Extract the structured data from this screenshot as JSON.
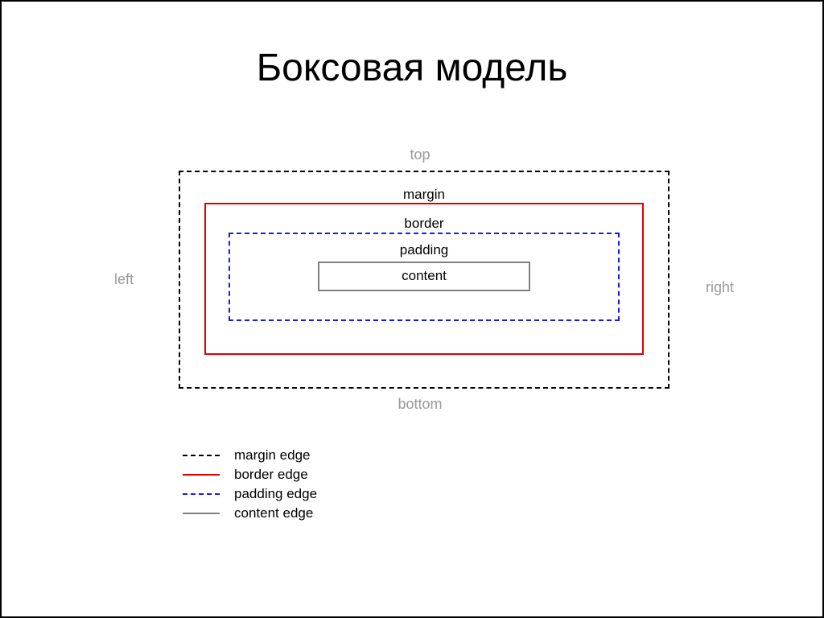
{
  "title": "Боксовая модель",
  "directions": {
    "top": "top",
    "left": "left",
    "right": "right",
    "bottom": "bottom"
  },
  "boxes": {
    "margin": "margin",
    "border": "border",
    "padding": "padding",
    "content": "content"
  },
  "legend": {
    "margin": "margin edge",
    "border": "border edge",
    "padding": "padding edge",
    "content": "content edge"
  },
  "colors": {
    "margin_edge": "#000000",
    "border_edge": "#e00000",
    "padding_edge": "#1a1ae6",
    "content_edge": "#808080",
    "muted_text": "#9a9a9a"
  }
}
